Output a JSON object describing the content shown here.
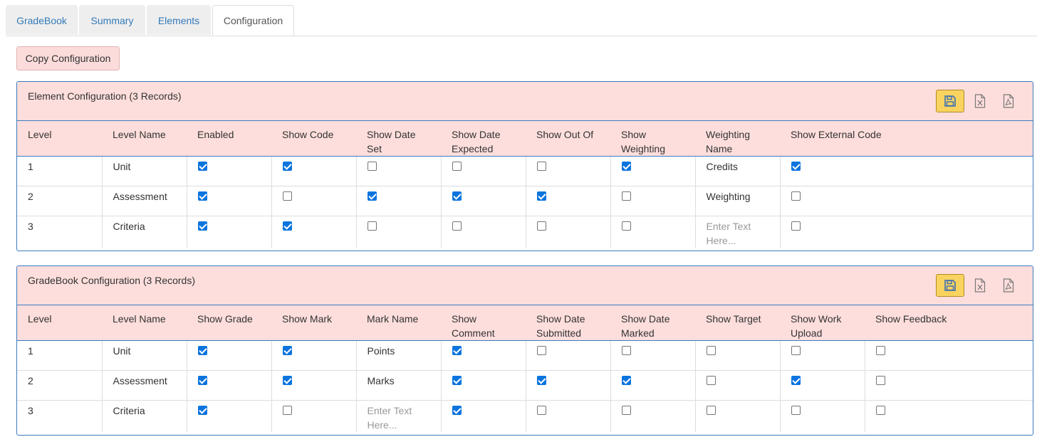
{
  "tabs": [
    {
      "label": "GradeBook"
    },
    {
      "label": "Summary"
    },
    {
      "label": "Elements"
    },
    {
      "label": "Configuration"
    }
  ],
  "copy_button": "Copy Configuration",
  "element_panel": {
    "title": "Element Configuration (3 Records)",
    "headers": [
      "Level",
      "Level Name",
      "Enabled",
      "Show Code",
      "Show Date Set",
      "Show Date Expected",
      "Show Out Of",
      "Show Weighting",
      "Weighting Name",
      "Show External Code"
    ],
    "rows": [
      {
        "level": "1",
        "name": "Unit",
        "enabled": true,
        "show_code": true,
        "date_set": false,
        "date_expected": false,
        "out_of": false,
        "weighting": true,
        "weighting_name": "Credits",
        "external_code": true
      },
      {
        "level": "2",
        "name": "Assessment",
        "enabled": true,
        "show_code": false,
        "date_set": true,
        "date_expected": true,
        "out_of": true,
        "weighting": false,
        "weighting_name": "Weighting",
        "external_code": false
      },
      {
        "level": "3",
        "name": "Criteria",
        "enabled": true,
        "show_code": true,
        "date_set": false,
        "date_expected": false,
        "out_of": false,
        "weighting": false,
        "weighting_name": "",
        "external_code": false
      }
    ],
    "placeholder": "Enter Text Here..."
  },
  "gradebook_panel": {
    "title": "GradeBook Configuration (3 Records)",
    "headers": [
      "Level",
      "Level Name",
      "Show Grade",
      "Show Mark",
      "Mark Name",
      "Show Comment",
      "Show Date Submitted",
      "Show Date Marked",
      "Show Target",
      "Show Work Upload",
      "Show Feedback"
    ],
    "rows": [
      {
        "level": "1",
        "name": "Unit",
        "grade": true,
        "mark": true,
        "mark_name": "Points",
        "comment": true,
        "date_submitted": false,
        "date_marked": false,
        "target": false,
        "work_upload": false,
        "feedback": false
      },
      {
        "level": "2",
        "name": "Assessment",
        "grade": true,
        "mark": true,
        "mark_name": "Marks",
        "comment": true,
        "date_submitted": true,
        "date_marked": true,
        "target": false,
        "work_upload": true,
        "feedback": false
      },
      {
        "level": "3",
        "name": "Criteria",
        "grade": true,
        "mark": false,
        "mark_name": "",
        "comment": true,
        "date_submitted": false,
        "date_marked": false,
        "target": false,
        "work_upload": false,
        "feedback": false
      }
    ],
    "placeholder": "Enter Text Here..."
  },
  "icons": {
    "save": "save-icon",
    "excel": "excel-icon",
    "pdf": "pdf-icon"
  },
  "colors": {
    "panel_bg": "#fddedc",
    "panel_border": "#3a7bc0",
    "save_bg": "#f9d35f",
    "checkbox": "#0b74de",
    "link": "#337ab7"
  }
}
